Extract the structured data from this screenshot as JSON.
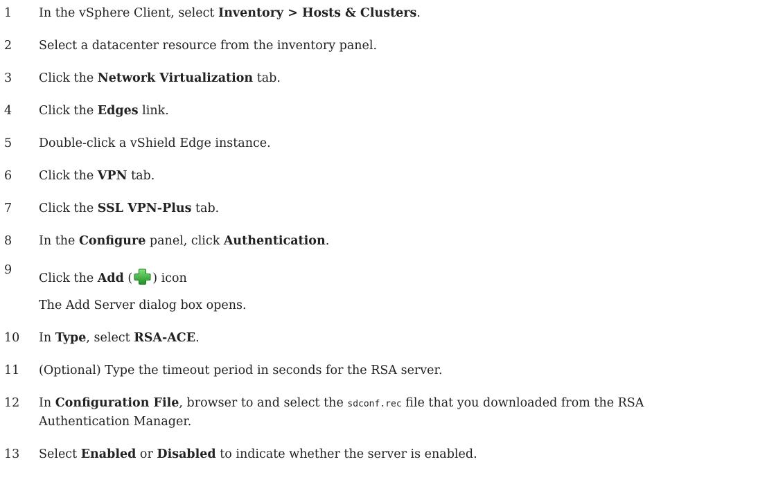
{
  "steps": [
    {
      "num": "1",
      "parts": [
        "In the vSphere Client, select ",
        "Inventory > Hosts & Clusters",
        "."
      ]
    },
    {
      "num": "2",
      "text": "Select a datacenter resource from the inventory panel."
    },
    {
      "num": "3",
      "parts": [
        "Click the ",
        "Network Virtualization",
        " tab."
      ]
    },
    {
      "num": "4",
      "parts": [
        "Click the ",
        "Edges",
        " link."
      ]
    },
    {
      "num": "5",
      "text": "Double-click a vShield Edge instance."
    },
    {
      "num": "6",
      "parts": [
        "Click the ",
        "VPN",
        " tab."
      ]
    },
    {
      "num": "7",
      "parts": [
        "Click the ",
        "SSL VPN-Plus",
        " tab."
      ]
    },
    {
      "num": "8",
      "parts": [
        "In the ",
        "Configure",
        " panel, click ",
        "Authentication",
        "."
      ]
    },
    {
      "num": "9",
      "parts": [
        "Click the ",
        "Add",
        " (",
        ") icon"
      ],
      "icon": "green-plus-icon",
      "note": "The Add Server dialog box opens."
    },
    {
      "num": "10",
      "parts": [
        "In ",
        "Type",
        ", select ",
        "RSA-ACE",
        "."
      ]
    },
    {
      "num": "11",
      "text": "(Optional) Type the timeout period in seconds for the RSA server."
    },
    {
      "num": "12",
      "parts": [
        "In ",
        "Configuration File",
        ", browser to and select the ",
        "sdconf.rec",
        " file that you downloaded from the RSA"
      ],
      "line2": "Authentication Manager."
    },
    {
      "num": "13",
      "parts": [
        "Select ",
        "Enabled",
        " or ",
        "Disabled",
        " to indicate whether the server is enabled."
      ]
    }
  ],
  "icon_color": "#2ea82e"
}
